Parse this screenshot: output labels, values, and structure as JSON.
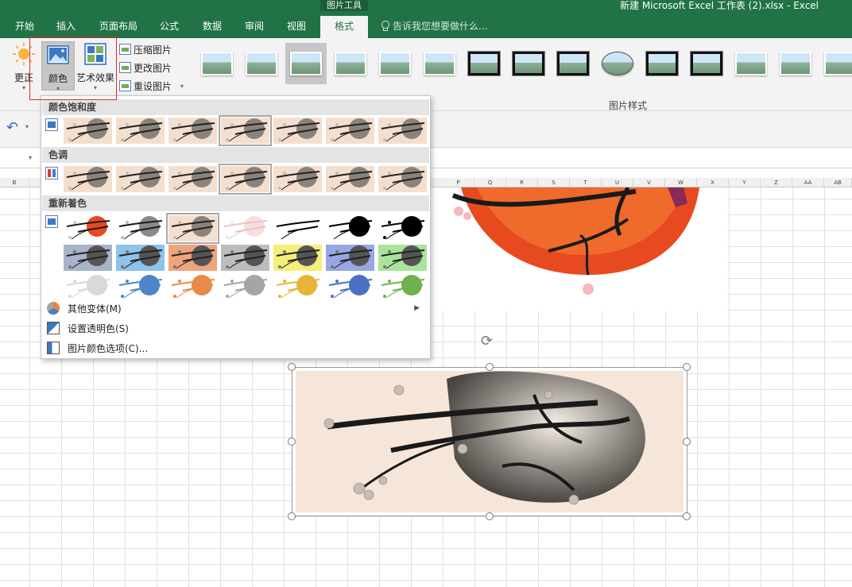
{
  "window": {
    "title": "新建 Microsoft Excel 工作表 (2).xlsx - Excel",
    "context_group": "图片工具"
  },
  "tabs": [
    {
      "label": "开始"
    },
    {
      "label": "插入"
    },
    {
      "label": "页面布局"
    },
    {
      "label": "公式"
    },
    {
      "label": "数据"
    },
    {
      "label": "审阅"
    },
    {
      "label": "视图"
    },
    {
      "label": "格式",
      "active": true
    }
  ],
  "tell_me": {
    "placeholder": "告诉我您想要做什么..."
  },
  "ribbon": {
    "correct_label": "更正",
    "color_label": "颜色",
    "artistic_label": "艺术效果",
    "compress_label": "压缩图片",
    "change_label": "更改图片",
    "reset_label": "重设图片",
    "styles_group_label": "图片样式",
    "style_thumb_count": 15,
    "highlight_color": "#e3292d"
  },
  "color_panel": {
    "saturation_title": "颜色饱和度",
    "tone_title": "色调",
    "recolor_title": "重新着色",
    "saturation_count": 7,
    "saturation_selected": 3,
    "tone_count": 7,
    "tone_selected": 3,
    "recolor_rows": [
      [
        "original-color",
        "grayscale",
        "sepia",
        "washout",
        "black-white-25",
        "black-white-50",
        "black-white-75"
      ],
      [
        "dark-blue-gray",
        "blue",
        "orange",
        "dark-gray",
        "gold",
        "dark-blue",
        "green"
      ],
      [
        "light-gray",
        "light-blue",
        "light-orange",
        "light-gray-2",
        "light-gold",
        "light-blue-2",
        "light-green"
      ]
    ],
    "recolor_selected": 2,
    "recolor_swatch_colors": {
      "row2": [
        "#a9b3c9",
        "#8ec3ea",
        "#f0a47b",
        "#bdbdbd",
        "#f6ee7a",
        "#97a7e4",
        "#a9e49a"
      ],
      "row3": [
        "#d9d9d9",
        "#4c86c8",
        "#e88a48",
        "#a5a5a5",
        "#e8b53a",
        "#4a6fc4",
        "#6fb04f"
      ]
    },
    "more_variants_label": "其他变体(M)",
    "set_transparent_label": "设置透明色(S)",
    "options_label": "图片颜色选项(C)..."
  },
  "sheet": {
    "columns": [
      "B",
      "P",
      "Q",
      "R",
      "S",
      "T",
      "U",
      "V",
      "W",
      "X",
      "Y",
      "Z",
      "AA",
      "AB"
    ]
  },
  "colors": {
    "ribbon_green": "#217346",
    "image_bg": "#f6e6d9",
    "moon_red": "#e74a1f"
  }
}
